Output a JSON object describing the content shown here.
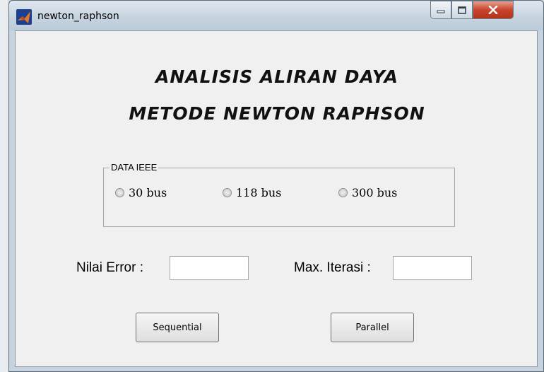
{
  "window": {
    "title": "newton_raphson",
    "controls": {
      "minimize": "minimize",
      "maximize": "maximize",
      "close": "close"
    }
  },
  "heading": {
    "line1": "ANALISIS ALIRAN DAYA",
    "line2": "METODE NEWTON RAPHSON"
  },
  "data_group": {
    "label": "DATA IEEE",
    "options": [
      {
        "label": "30 bus",
        "selected": false
      },
      {
        "label": "118 bus",
        "selected": false
      },
      {
        "label": "300 bus",
        "selected": false
      }
    ]
  },
  "inputs": {
    "error_label": "Nilai Error :",
    "error_value": "",
    "iter_label": "Max. Iterasi :",
    "iter_value": ""
  },
  "buttons": {
    "sequential": "Sequential",
    "parallel": "Parallel"
  },
  "icons": [
    "matlab-icon",
    "minimize-icon",
    "maximize-icon",
    "close-icon"
  ],
  "colors": {
    "close_button": "#c8442b",
    "client_bg": "#f0f0f0"
  }
}
